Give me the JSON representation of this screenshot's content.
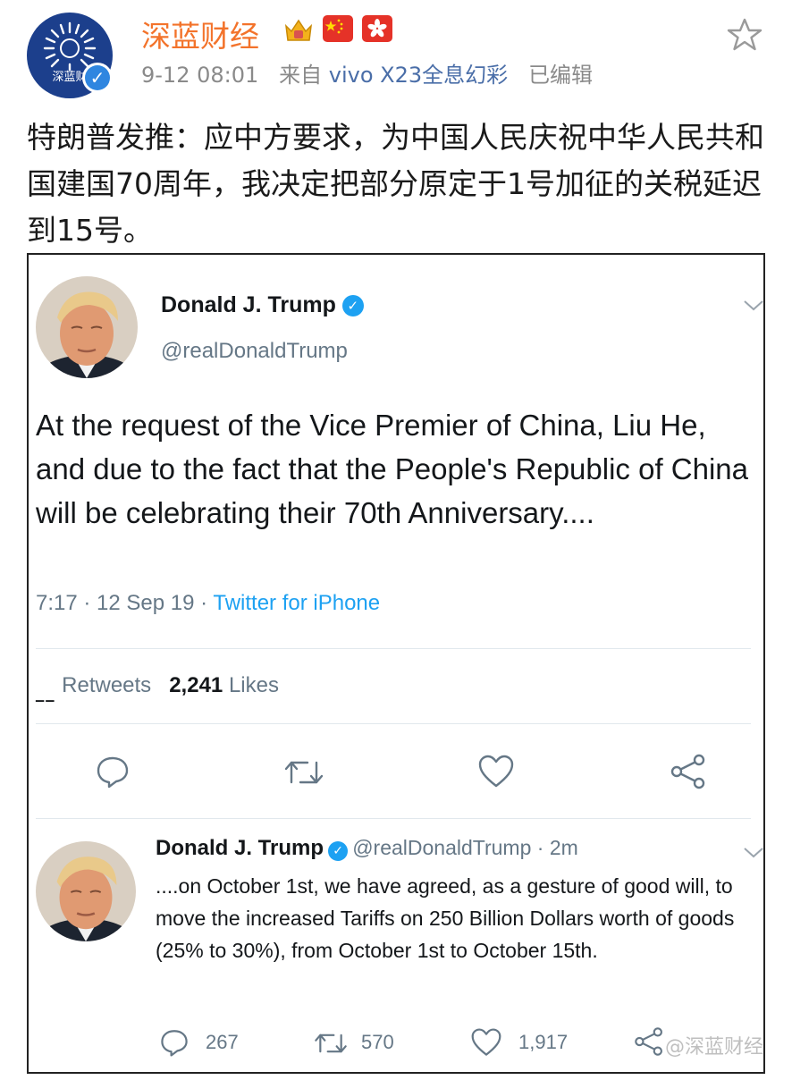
{
  "account": {
    "name": "深蓝财经",
    "avatar_text": "深蓝财",
    "time": "9-12 08:01",
    "from_label": "来自",
    "device": "vivo X23全息幻彩",
    "edited": "已编辑"
  },
  "post": {
    "text": "特朗普发推：应中方要求，为中国人民庆祝中华人民共和国建国70周年，我决定把部分原定于1号加征的关税延迟到15号。"
  },
  "tweet1": {
    "name": "Donald J. Trump",
    "handle": "@realDonaldTrump",
    "body": "At the request of the Vice Premier of China, Liu He, and due to the fact that the People's Republic of China will be celebrating their 70th Anniversary....",
    "time_date": "7:17 · 12 Sep 19 · ",
    "source": "Twitter for iPhone",
    "retweets_label": "Retweets",
    "likes_count": "2,241",
    "likes_label": "Likes"
  },
  "tweet2": {
    "name": "Donald J. Trump",
    "handle_time": "@realDonaldTrump · 2m",
    "body": "....on October 1st, we have agreed, as a gesture of good will, to move the increased Tariffs on 250 Billion Dollars worth of goods (25% to 30%), from October 1st to October 15th.",
    "replies": "267",
    "retweets": "570",
    "likes": "1,917"
  },
  "watermark": "@深蓝财经",
  "colors": {
    "weibo_orange": "#f3732b",
    "twitter_blue": "#1da1f2",
    "meta_gray": "#8a8a8a"
  }
}
